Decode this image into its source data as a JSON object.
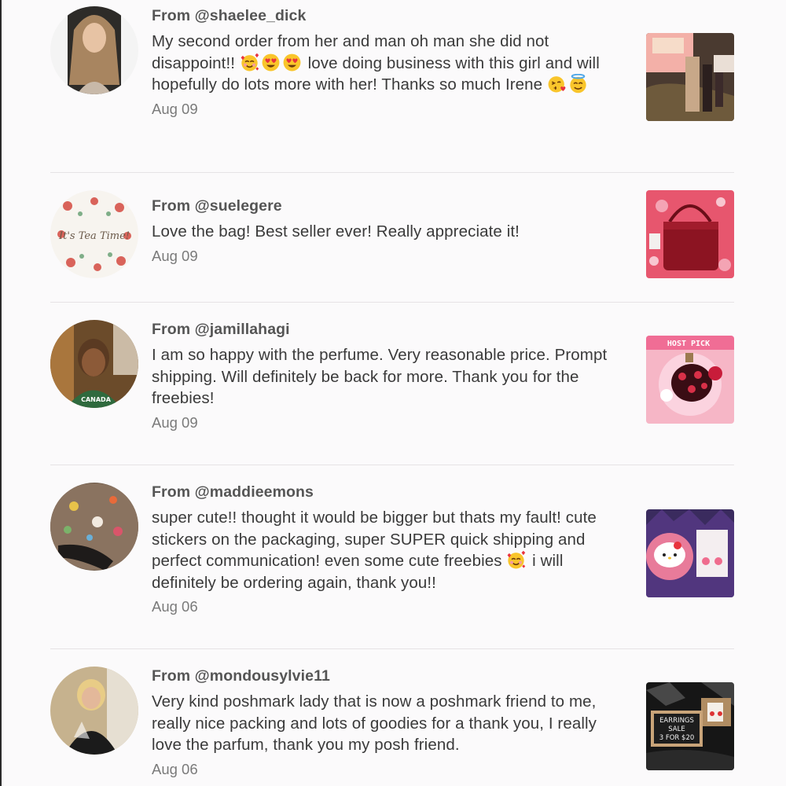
{
  "reviews": [
    {
      "from": "From @shaelee_dick",
      "text_parts": [
        "My second order from her and man oh man she did not disappoint!! ",
        " love doing business with this girl and will hopefully do lots more with her! Thanks so much Irene "
      ],
      "emojis_1": [
        "smiling-face-with-hearts",
        "heart-eyes",
        "heart-eyes"
      ],
      "emojis_2": [
        "face-blowing-kiss",
        "smiling-face-with-halo"
      ],
      "date": "Aug 09"
    },
    {
      "from": "From @suelegere",
      "text": "Love the bag! Best seller ever! Really appreciate it!",
      "avatar_caption": "It's Tea Time!",
      "date": "Aug 09"
    },
    {
      "from": "From @jamillahagi",
      "text": "I am so happy with the perfume. Very reasonable price. Prompt shipping. Will definitely be back for more. Thank you for the freebies!",
      "thumb_badge": "HOST PICK",
      "date": "Aug 09"
    },
    {
      "from": "From @maddieemons",
      "text_parts": [
        "super cute!! thought it would be bigger but thats my fault! cute stickers on the packaging, super SUPER quick shipping and perfect communication! even some cute freebies ",
        " i will definitely be ordering again, thank you!!"
      ],
      "emojis_1": [
        "smiling-face-with-hearts"
      ],
      "date": "Aug 06"
    },
    {
      "from": "From @mondousylvie11",
      "text": "Very kind poshmark lady that is now a poshmark friend to me, really nice packing and lots of goodies for a thank you, I really love the parfum, thank you my posh friend.",
      "thumb_sign": [
        "EARRINGS",
        "SALE",
        "3 FOR $20"
      ],
      "date": "Aug 06"
    }
  ]
}
